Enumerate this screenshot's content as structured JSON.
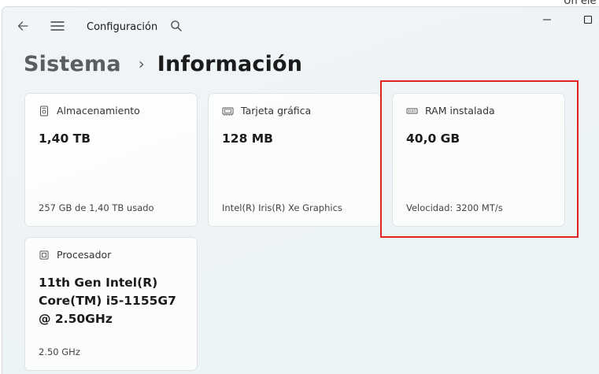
{
  "behind": {
    "text": "Un ele"
  },
  "titlebar": {
    "title": "Configuración",
    "back_icon": "back-arrow-icon",
    "menu_icon": "hamburger-menu-icon",
    "search_icon": "search-icon"
  },
  "breadcrumb": {
    "parent": "Sistema",
    "separator": "›",
    "current": "Información"
  },
  "cards": {
    "storage": {
      "icon": "storage-icon",
      "label": "Almacenamiento",
      "value": "1,40 TB",
      "sub": "257 GB de 1,40 TB usado"
    },
    "gpu": {
      "icon": "graphics-card-icon",
      "label": "Tarjeta gráfica",
      "value": "128 MB",
      "sub": "Intel(R) Iris(R) Xe Graphics"
    },
    "ram": {
      "icon": "ram-icon",
      "label": "RAM instalada",
      "value": "40,0 GB",
      "sub": "Velocidad: 3200 MT/s"
    },
    "cpu": {
      "icon": "processor-icon",
      "label": "Procesador",
      "value": "11th Gen Intel(R) Core(TM) i5-1155G7 @ 2.50GHz",
      "sub": "2.50 GHz"
    }
  },
  "colors": {
    "highlight": "#e02424"
  }
}
